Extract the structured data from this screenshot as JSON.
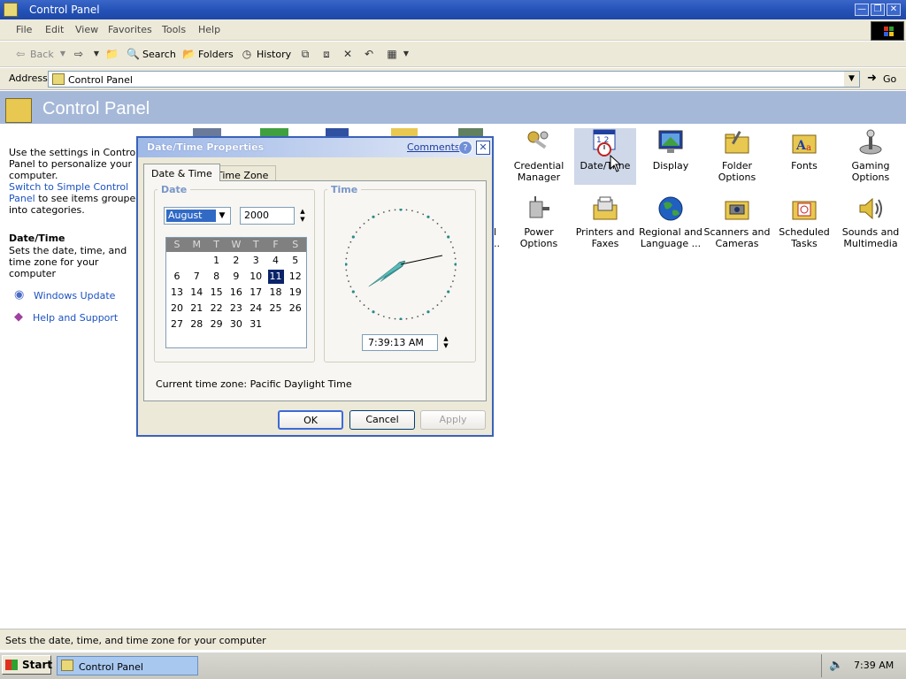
{
  "window": {
    "title": "Control Panel"
  },
  "menu": [
    "File",
    "Edit",
    "View",
    "Favorites",
    "Tools",
    "Help"
  ],
  "toolbar": {
    "back": "Back",
    "search": "Search",
    "folders": "Folders",
    "history": "History"
  },
  "address": {
    "label": "Address",
    "value": "Control Panel",
    "go": "Go"
  },
  "header": {
    "title": "Control Panel"
  },
  "leftpane": {
    "intro": "Use the settings in Control Panel to personalize your computer.",
    "switch_link": "Switch to Simple Control Panel",
    "switch_rest": "to see items grouped into categories.",
    "detail_title": "Date/Time",
    "detail_text": "Sets the date, time, and time zone for your computer",
    "links": [
      "Windows Update",
      "Help and Support"
    ]
  },
  "items_row1": [
    "Credential Manager",
    "Date/Time",
    "Display",
    "Folder Options",
    "Fonts",
    "Gaming Options"
  ],
  "items_row2": [
    "Power Options",
    "Printers and Faxes",
    "Regional and Language ...",
    "Scanners and Cameras",
    "Scheduled Tasks",
    "Sounds and Multimedia"
  ],
  "status": {
    "text": "Sets the date, time, and time zone for your computer"
  },
  "taskbar": {
    "start": "Start",
    "task": "Control Panel",
    "clock": "7:39 AM"
  },
  "dialog": {
    "title": "Date/Time Properties",
    "comments": "Comments?",
    "tabs": [
      "Date & Time",
      "Time Zone"
    ],
    "date_group": "Date",
    "time_group": "Time",
    "month": "August",
    "year": "2000",
    "weekdays": [
      "S",
      "M",
      "T",
      "W",
      "T",
      "F",
      "S"
    ],
    "weeks": [
      [
        "",
        "",
        "1",
        "2",
        "3",
        "4",
        "5"
      ],
      [
        "6",
        "7",
        "8",
        "9",
        "10",
        "11",
        "12"
      ],
      [
        "13",
        "14",
        "15",
        "16",
        "17",
        "18",
        "19"
      ],
      [
        "20",
        "21",
        "22",
        "23",
        "24",
        "25",
        "26"
      ],
      [
        "27",
        "28",
        "29",
        "30",
        "31",
        "",
        ""
      ]
    ],
    "selected_day": "11",
    "time": "7:39:13 AM",
    "timezone_label": "Current time zone:",
    "timezone": "Pacific Daylight Time",
    "ok": "OK",
    "cancel": "Cancel",
    "apply": "Apply"
  }
}
